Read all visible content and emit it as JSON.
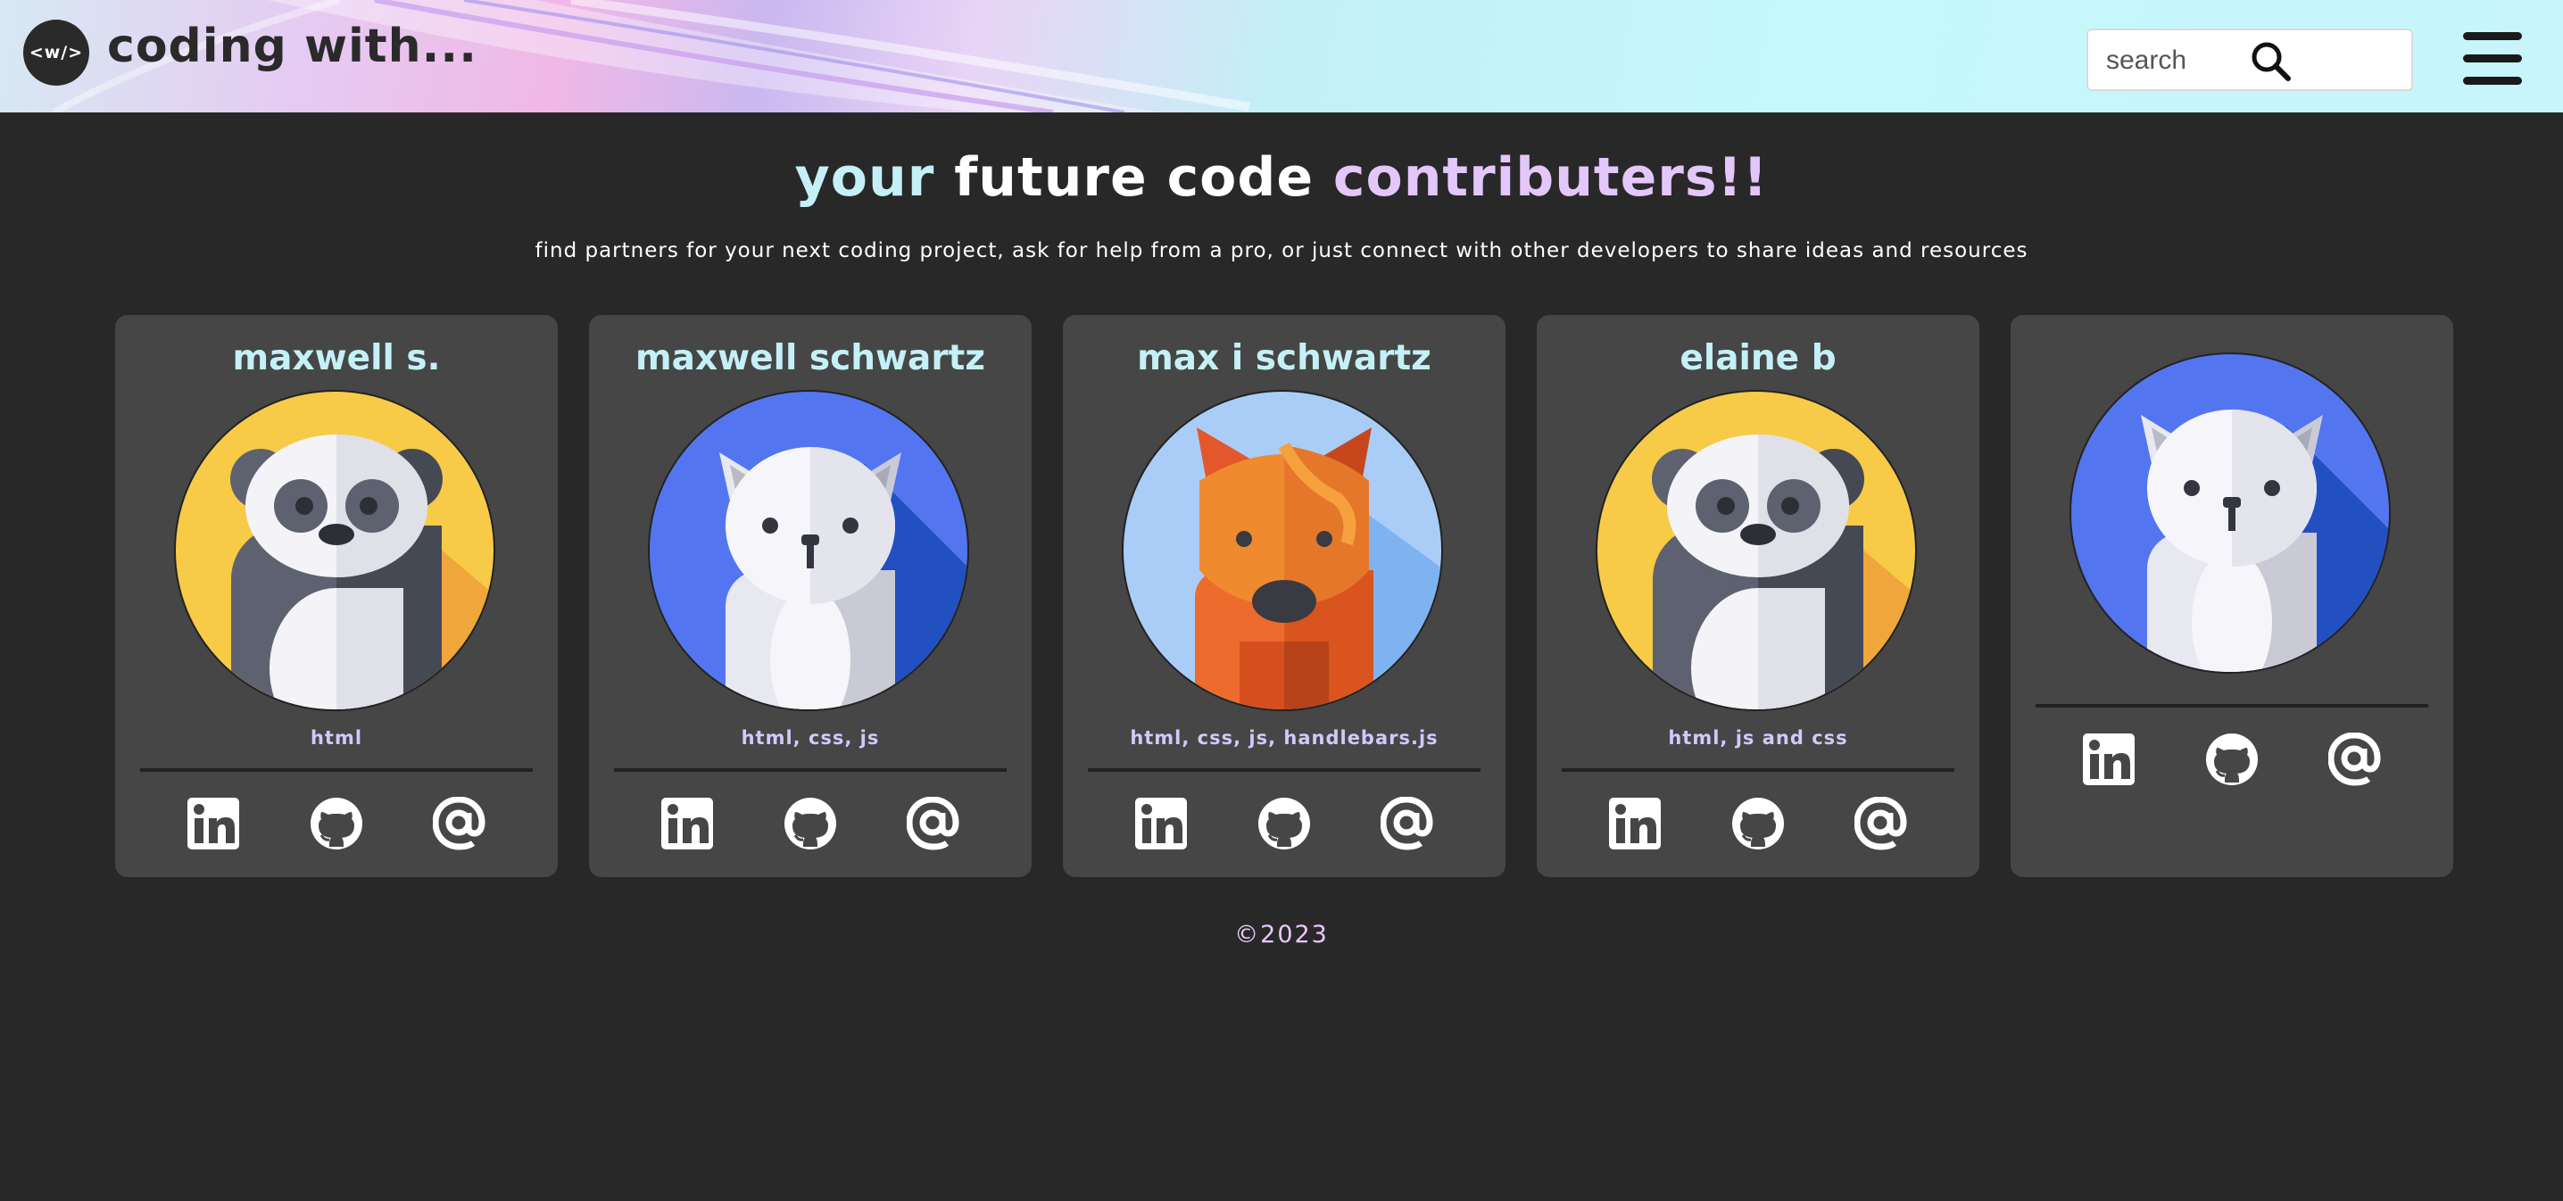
{
  "header": {
    "logo_text": "<w/>",
    "brand": "coding with...",
    "search": {
      "placeholder": "search",
      "icon": "search-icon"
    },
    "menu_icon": "hamburger-menu-icon"
  },
  "hero": {
    "title_part1": "your",
    "title_part2": " future code ",
    "title_part3": "contributers!!",
    "subtitle": "find partners for your next coding project, ask for help from a pro, or just connect with other developers to share ideas and resources"
  },
  "cards": [
    {
      "name": "maxwell s.",
      "avatar": "panda-avatar",
      "skills": "html",
      "links": [
        "linkedin-icon",
        "github-icon",
        "email-icon"
      ]
    },
    {
      "name": "maxwell schwartz",
      "avatar": "cat-avatar",
      "skills": "html, css, js",
      "links": [
        "linkedin-icon",
        "github-icon",
        "email-icon"
      ]
    },
    {
      "name": "max i schwartz",
      "avatar": "fox-avatar",
      "skills": "html, css, js, handlebars.js",
      "links": [
        "linkedin-icon",
        "github-icon",
        "email-icon"
      ]
    },
    {
      "name": "elaine b",
      "avatar": "panda-avatar",
      "skills": "html, js and css",
      "links": [
        "linkedin-icon",
        "github-icon",
        "email-icon"
      ]
    },
    {
      "name": "",
      "avatar": "cat-avatar",
      "skills": "",
      "links": [
        "linkedin-icon",
        "github-icon",
        "email-icon"
      ]
    }
  ],
  "footer": {
    "copyright": "©2023"
  },
  "colors": {
    "background": "#282828",
    "card": "#464646",
    "accent_cyan": "#c4f0f8",
    "accent_lavender": "#e4c7fa"
  }
}
